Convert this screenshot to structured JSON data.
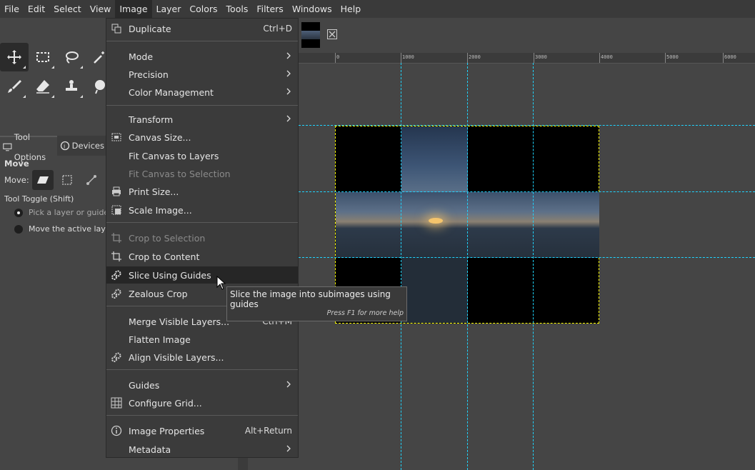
{
  "menubar": {
    "items": [
      "File",
      "Edit",
      "Select",
      "View",
      "Image",
      "Layer",
      "Colors",
      "Tools",
      "Filters",
      "Windows",
      "Help"
    ],
    "active": "Image"
  },
  "dock": {
    "tabs": [
      "Tool Options",
      "Devices"
    ],
    "tool_title": "Move",
    "move_label": "Move:",
    "toggle_label": "Tool Toggle  (Shift)",
    "options": [
      "Pick a layer or guide",
      "Move the active layer"
    ]
  },
  "ruler": {
    "ticks": [
      "0",
      "1000",
      "2000",
      "3000",
      "4000",
      "5000",
      "6000"
    ]
  },
  "menu": {
    "items": [
      {
        "label": "Duplicate",
        "accel": "Ctrl+D",
        "icon": "duplicate-icon"
      },
      {
        "label": "Mode",
        "submenu": true
      },
      {
        "label": "Precision",
        "submenu": true
      },
      {
        "label": "Color Management",
        "submenu": true
      },
      {
        "label": "Transform",
        "submenu": true
      },
      {
        "label": "Canvas Size...",
        "icon": "canvas-size-icon"
      },
      {
        "label": "Fit Canvas to Layers"
      },
      {
        "label": "Fit Canvas to Selection",
        "disabled": true
      },
      {
        "label": "Print Size...",
        "icon": "print-icon"
      },
      {
        "label": "Scale Image...",
        "icon": "scale-icon"
      },
      {
        "label": "Crop to Selection",
        "disabled": true,
        "icon": "crop-icon"
      },
      {
        "label": "Crop to Content",
        "icon": "crop-icon"
      },
      {
        "label": "Slice Using Guides",
        "icon": "gears-icon",
        "highlighted": true
      },
      {
        "label": "Zealous Crop",
        "icon": "gears-icon"
      },
      {
        "label": "Merge Visible Layers...",
        "accel": "Ctrl+M"
      },
      {
        "label": "Flatten Image"
      },
      {
        "label": "Align Visible Layers...",
        "icon": "gears-icon"
      },
      {
        "label": "Guides",
        "submenu": true
      },
      {
        "label": "Configure Grid...",
        "icon": "grid-icon"
      },
      {
        "label": "Image Properties",
        "accel": "Alt+Return",
        "icon": "info-icon"
      },
      {
        "label": "Metadata",
        "submenu": true
      }
    ]
  },
  "tooltip": {
    "text": "Slice the image into subimages using guides",
    "help": "Press F1 for more help"
  },
  "colors": {
    "menu_bg": "#3b3b3b",
    "highlight": "#262626",
    "guide": "#1fd4ff",
    "layer_boundary": "#ffff00"
  }
}
